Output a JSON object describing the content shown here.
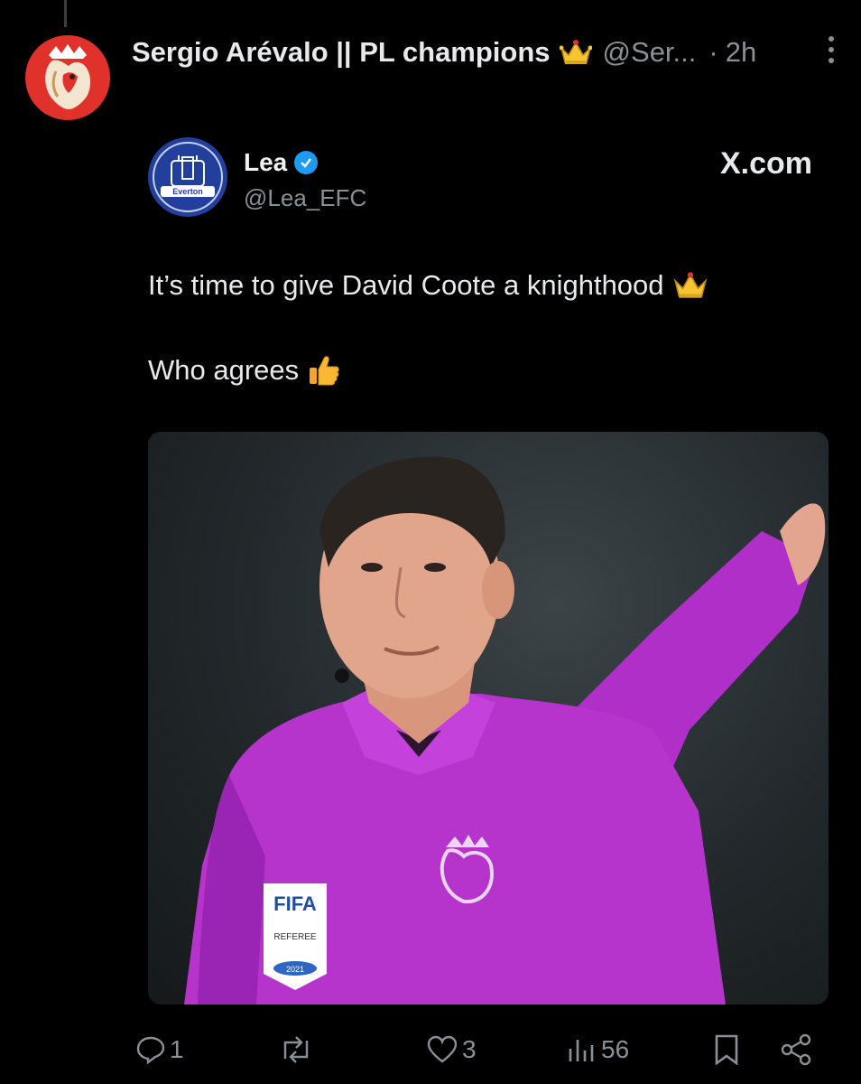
{
  "tweet": {
    "author_name": "Sergio Arévalo || PL champions",
    "handle": "@Ser...",
    "separator": "·",
    "time": "2h",
    "avatar_icon": "premier-league-lion-icon",
    "accent_color": "#e0322b"
  },
  "quoted": {
    "name": "Lea",
    "handle": "@Lea_EFC",
    "badge": "Everton",
    "source": "X.com",
    "line1": "It’s time to give David Coote a knighthood",
    "line2": "Who agrees",
    "photo_labels": {
      "badge_top": "FIFA",
      "badge_mid": "REFEREE",
      "badge_year": "2021"
    }
  },
  "actions": {
    "replies": "1",
    "reposts": "",
    "likes": "3",
    "views": "56"
  }
}
